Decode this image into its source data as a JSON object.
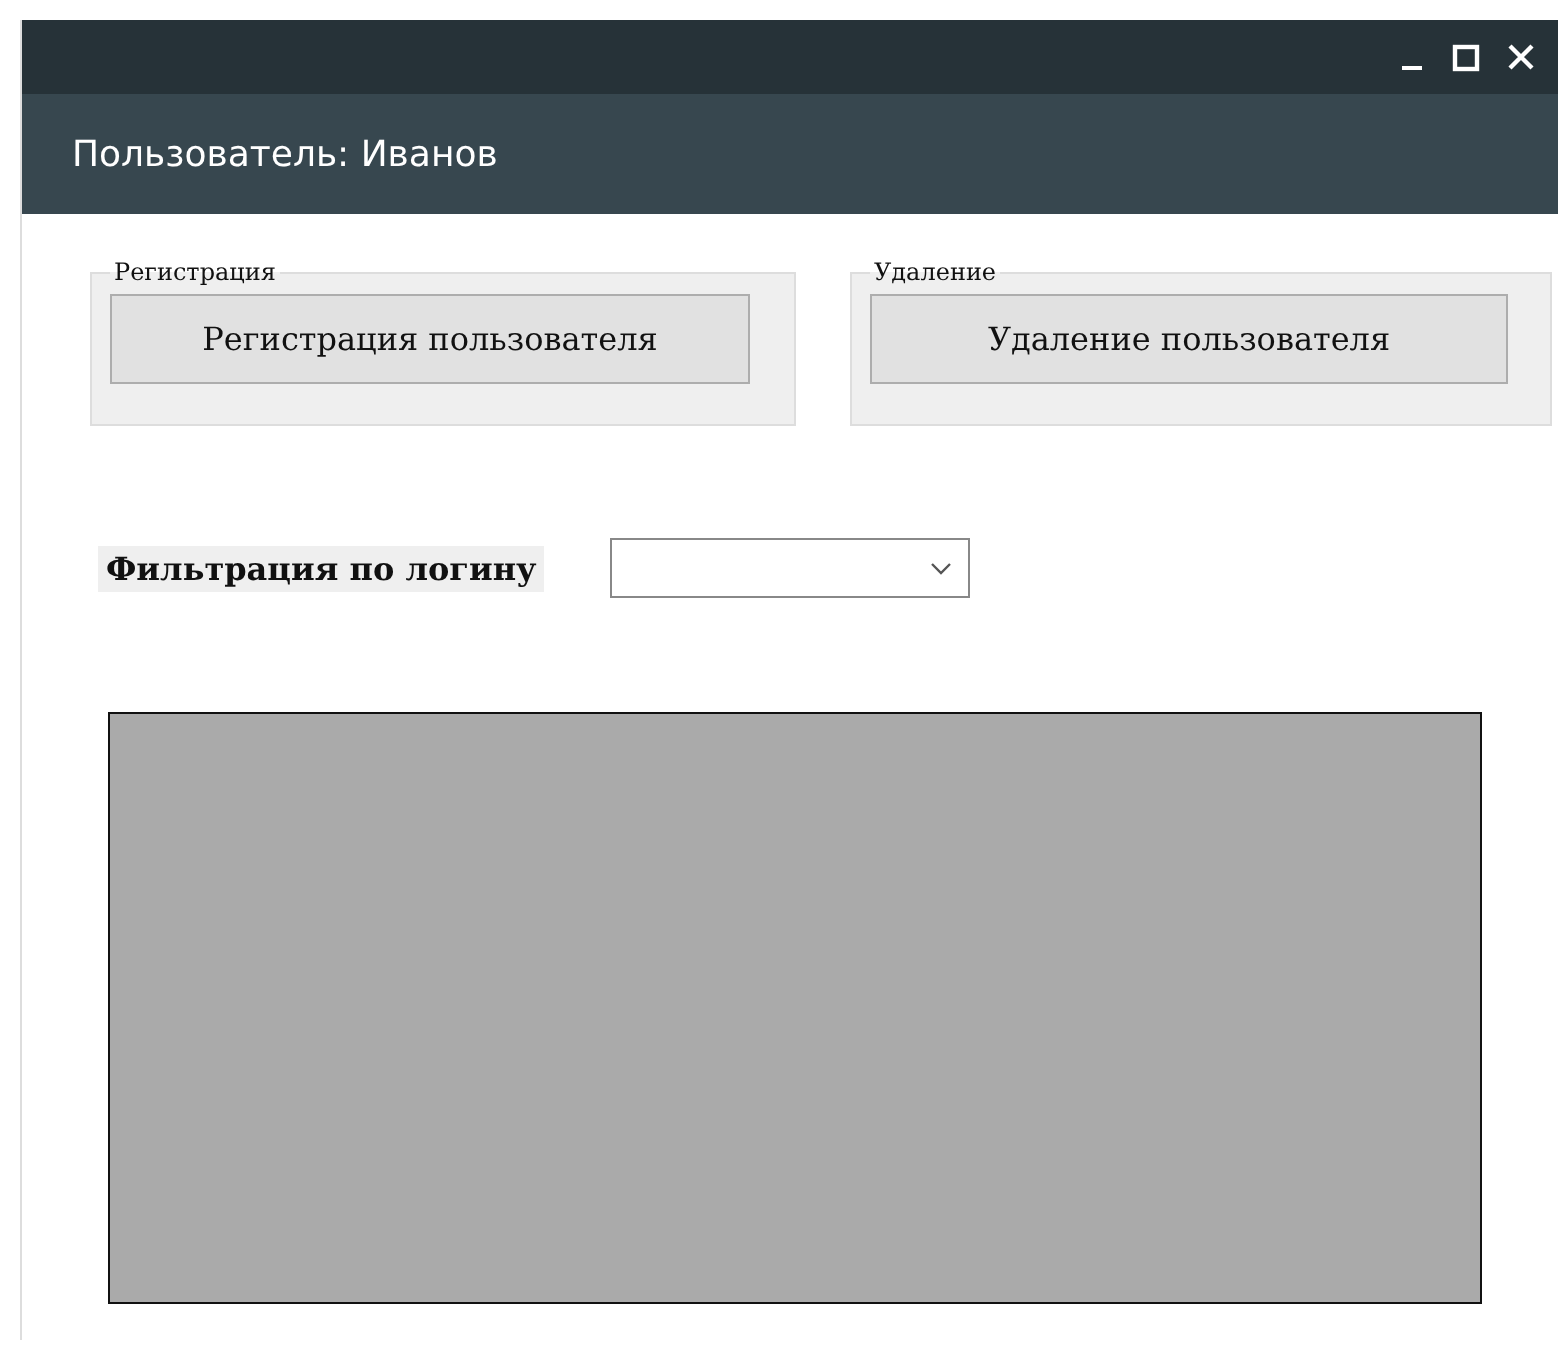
{
  "window": {
    "title": "Пользователь: Иванов"
  },
  "groups": [
    {
      "legend": "Регистрация",
      "button": "Регистрация пользователя"
    },
    {
      "legend": "Удаление",
      "button": "Удаление пользователя"
    }
  ],
  "filter": {
    "label": "Фильтрация по логину"
  },
  "grid": {
    "kind": "empty"
  }
}
